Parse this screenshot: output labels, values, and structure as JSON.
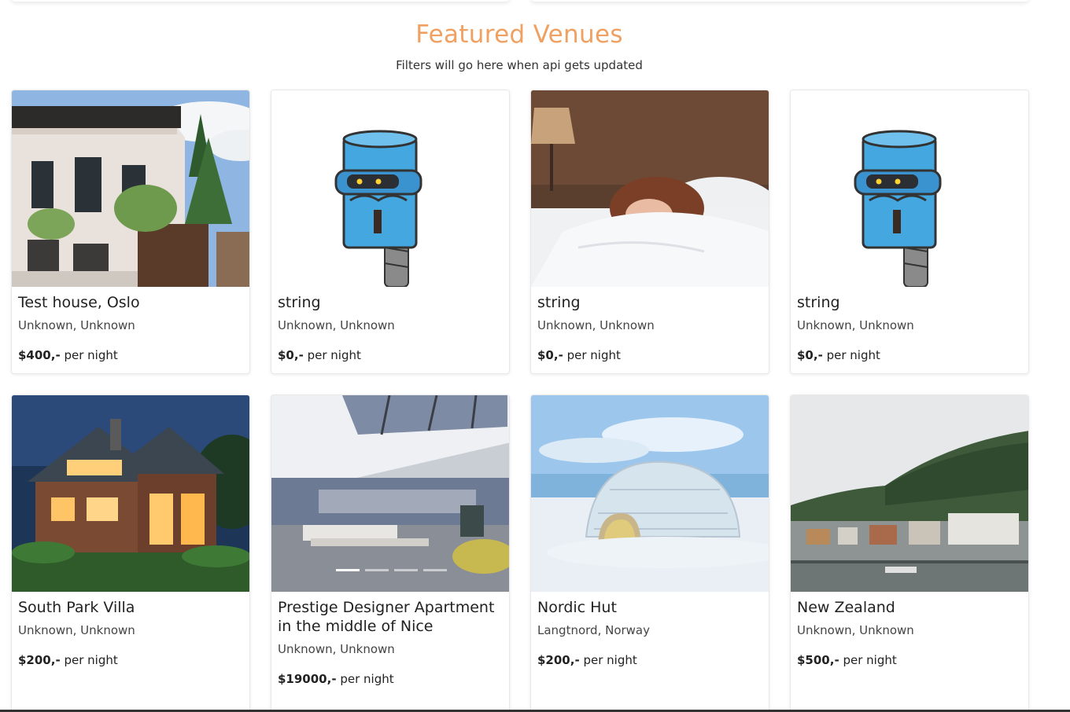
{
  "section": {
    "title": "Featured Venues",
    "subtitle": "Filters will go here when api gets updated"
  },
  "colors": {
    "accent": "#f0a060"
  },
  "price_suffix": "per night",
  "venues": [
    {
      "name": "Test house, Oslo",
      "location": "Unknown, Unknown",
      "price": "$400,-",
      "image": "white-villa-photo"
    },
    {
      "name": "string",
      "location": "Unknown, Unknown",
      "price": "$0,-",
      "image": "robot-placeholder"
    },
    {
      "name": "string",
      "location": "Unknown, Unknown",
      "price": "$0,-",
      "image": "woman-in-bed-photo"
    },
    {
      "name": "string",
      "location": "Unknown, Unknown",
      "price": "$0,-",
      "image": "robot-placeholder"
    },
    {
      "name": "South Park Villa",
      "location": "Unknown, Unknown",
      "price": "$200,-",
      "image": "wooden-house-night-photo"
    },
    {
      "name": "Prestige Designer Apartment in the middle of Nice",
      "location": "Unknown, Unknown",
      "price": "$19000,-",
      "image": "loft-apartment-photo",
      "carousel": {
        "slides": 4,
        "active": 1
      }
    },
    {
      "name": "Nordic Hut",
      "location": "Langtnord, Norway",
      "price": "$200,-",
      "image": "igloo-photo"
    },
    {
      "name": "New Zealand",
      "location": "Unknown, Unknown",
      "price": "$500,-",
      "image": "lake-town-photo"
    }
  ]
}
